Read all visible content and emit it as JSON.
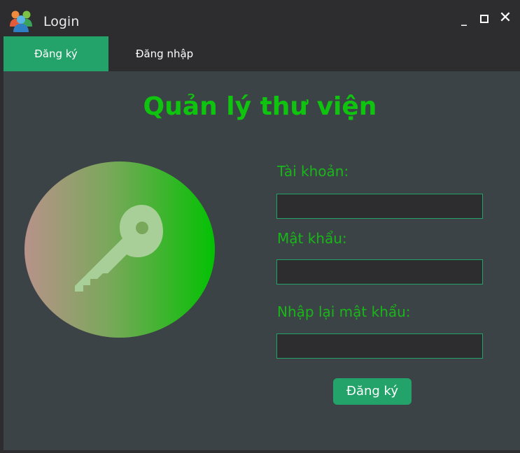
{
  "window": {
    "title": "Login",
    "minimize_glyph": "_",
    "close_glyph": "✕"
  },
  "tabs": [
    {
      "label": "Đăng ký",
      "active": true
    },
    {
      "label": "Đăng nhập",
      "active": false
    }
  ],
  "main": {
    "title": "Quản lý thư viện",
    "illustration_icon": "key-icon",
    "fields": [
      {
        "label": "Tài khoản:",
        "value": "",
        "placeholder": ""
      },
      {
        "label": "Mật khẩu:",
        "value": "",
        "placeholder": ""
      },
      {
        "label": "Nhập lại mật khẩu:",
        "value": "",
        "placeholder": ""
      }
    ],
    "submit_label": "Đăng ký"
  },
  "colors": {
    "accent": "#23a36a",
    "title_green": "#0fc40f",
    "label_green": "#19b619",
    "background": "#3c4346",
    "chrome": "#2d2d30"
  }
}
